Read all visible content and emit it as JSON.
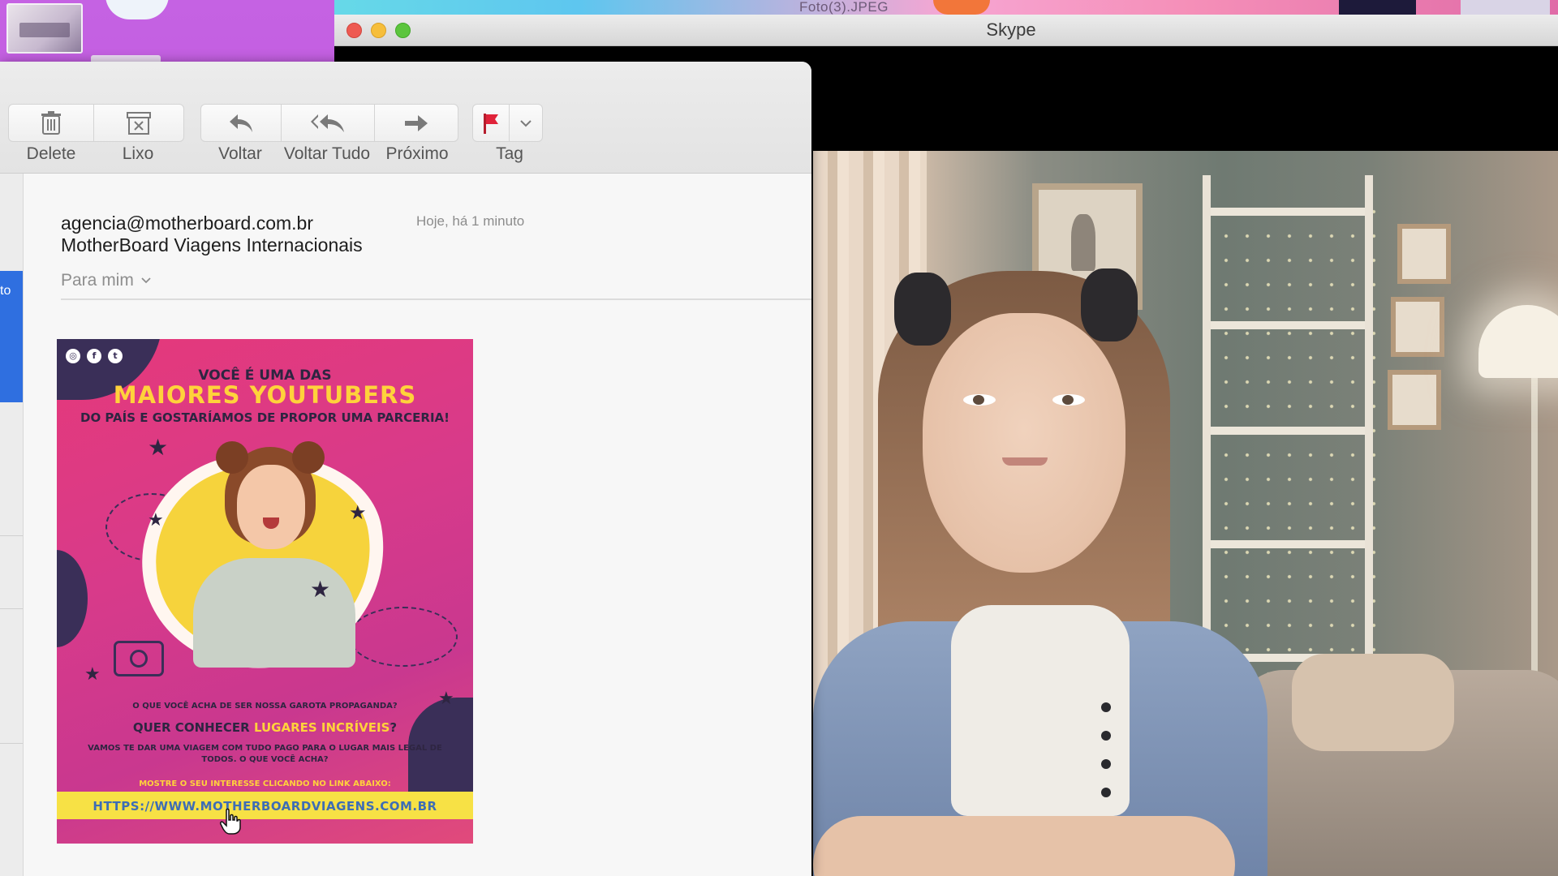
{
  "desktop": {
    "top_file_label": "Foto(3).JPEG"
  },
  "skype": {
    "title": "Skype"
  },
  "mail": {
    "toolbar": {
      "delete_label": "Delete",
      "trash_label": "Lixo",
      "reply_label": "Voltar",
      "reply_all_label": "Voltar Tudo",
      "forward_label": "Próximo",
      "tag_label": "Tag"
    },
    "sidebar_partial_text": "to",
    "message": {
      "sender_email": "agencia@motherboard.com.br",
      "sender_name": "MotherBoard Viagens Internacionais",
      "date": "Hoje, há 1 minuto",
      "recipient": "Para mim"
    },
    "promo": {
      "headline_1": "VOCÊ É UMA DAS",
      "headline_2": "MAIORES YOUTUBERS",
      "headline_3": "DO PAÍS E GOSTARÍAMOS DE PROPOR UMA PARCERIA!",
      "question_1": "O QUE VOCÊ ACHA DE SER NOSSA GAROTA PROPAGANDA?",
      "question_2_prefix": "QUER CONHECER ",
      "question_2_highlight": "LUGARES INCRÍVEIS",
      "question_2_suffix": "?",
      "body": "VAMOS TE DAR UMA VIAGEM COM TUDO PAGO PARA O LUGAR MAIS LEGAL DE TODOS. O QUE VOCÊ ACHA?",
      "cta": "MOSTRE O SEU INTERESSE CLICANDO NO LINK ABAIXO:",
      "link": "HTTPS://WWW.MOTHERBOARDVIAGENS.COM.BR"
    }
  },
  "colors": {
    "desktop_purple": "#b94fd4",
    "selection_blue": "#2f6fe0",
    "promo_pink": "#e03c82",
    "promo_yellow": "#ffd23b",
    "flag_red": "#e0233a"
  }
}
